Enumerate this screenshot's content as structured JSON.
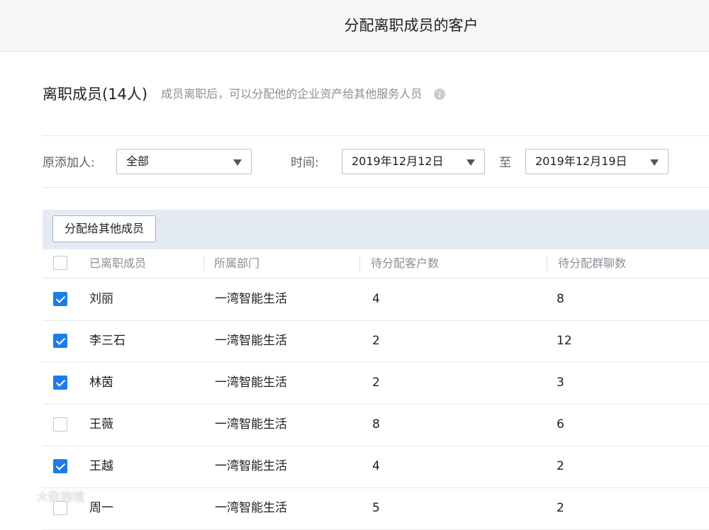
{
  "header": {
    "title": "分配离职成员的客户"
  },
  "section": {
    "title": "离职成员(14人)",
    "description": "成员离职后，可以分配他的企业资产给其他服务人员",
    "info_icon": "info-icon"
  },
  "filters": {
    "adder_label": "原添加人:",
    "adder_value": "全部",
    "time_label": "时间:",
    "start_date": "2019年12月12日",
    "to_label": "至",
    "end_date": "2019年12月19日"
  },
  "toolbar": {
    "assign_label": "分配给其他成员"
  },
  "table": {
    "columns": [
      "已离职成员",
      "所属部门",
      "待分配客户数",
      "待分配群聊数"
    ],
    "rows": [
      {
        "checked": true,
        "name": "刘丽",
        "dept": "一湾智能生活",
        "customers": "4",
        "groups": "8"
      },
      {
        "checked": true,
        "name": "李三石",
        "dept": "一湾智能生活",
        "customers": "2",
        "groups": "12"
      },
      {
        "checked": true,
        "name": "林茵",
        "dept": "一湾智能生活",
        "customers": "2",
        "groups": "3"
      },
      {
        "checked": false,
        "name": "王薇",
        "dept": "一湾智能生活",
        "customers": "8",
        "groups": "6"
      },
      {
        "checked": true,
        "name": "王越",
        "dept": "一湾智能生活",
        "customers": "4",
        "groups": "2"
      },
      {
        "checked": false,
        "name": "周一",
        "dept": "一湾智能生活",
        "customers": "5",
        "groups": "2"
      }
    ]
  },
  "colors": {
    "accent": "#1c7ce8",
    "toolbar_bg": "#e3eaf4"
  },
  "watermark": {
    "text": "大数跨境"
  }
}
